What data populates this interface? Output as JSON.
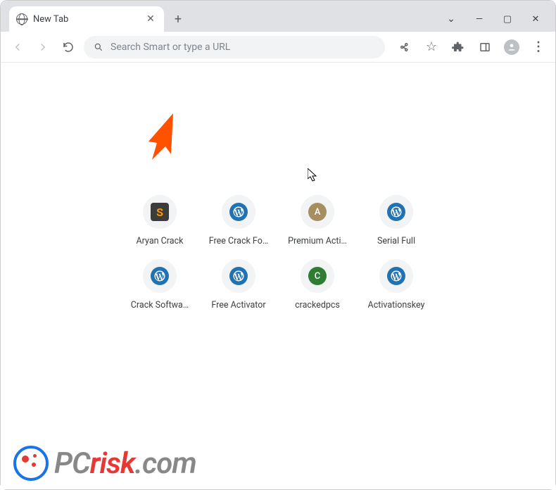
{
  "window": {
    "tab_title": "New Tab",
    "controls": {
      "dropdown": "⌄",
      "minimize": "—",
      "maximize": "▢",
      "close": "✕"
    }
  },
  "toolbar": {
    "omnibox_placeholder": "Search Smart or type a URL"
  },
  "shortcuts": [
    {
      "label": "Aryan Crack",
      "type": "sublime"
    },
    {
      "label": "Free Crack Fo…",
      "type": "wp"
    },
    {
      "label": "Premium Acti…",
      "type": "letter",
      "letter": "A",
      "color": "#a78e5e"
    },
    {
      "label": "Serial Full",
      "type": "wp"
    },
    {
      "label": "Crack Softwa…",
      "type": "wp"
    },
    {
      "label": "Free Activator",
      "type": "wp"
    },
    {
      "label": "crackedpcs",
      "type": "letter",
      "letter": "C",
      "color": "#2e7d32"
    },
    {
      "label": "Activationskey",
      "type": "wp"
    }
  ],
  "logo": {
    "text_pc": "PC",
    "text_risk": "risk",
    "text_com": ".com"
  }
}
